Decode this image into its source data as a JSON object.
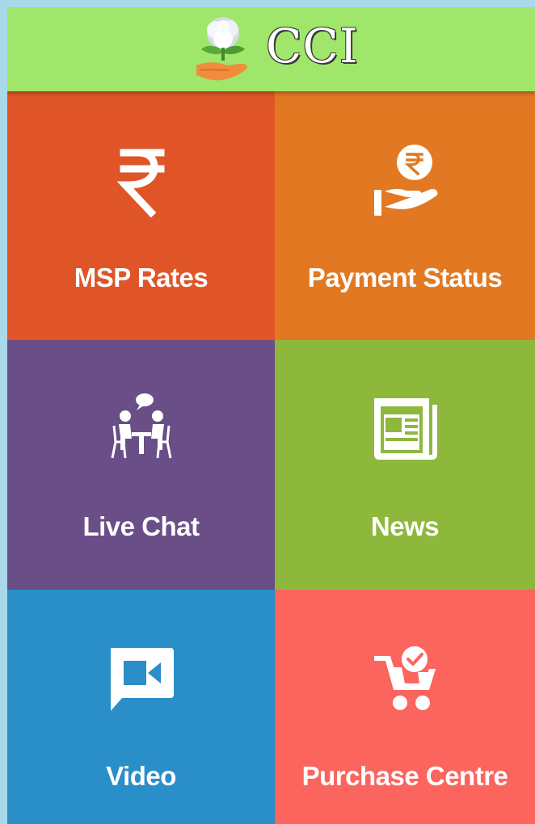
{
  "header": {
    "title": "CCI",
    "logo_icon": "cotton-plant-hand-icon"
  },
  "colors": {
    "header": "#9fe66a",
    "msp_rates": "#df5527",
    "payment_status": "#e27822",
    "live_chat": "#6a4e87",
    "news": "#8db83c",
    "video": "#2a8ec8",
    "purchase_centre": "#fc645e"
  },
  "tiles": [
    {
      "label": "MSP Rates",
      "icon": "rupee-icon"
    },
    {
      "label": "Payment Status",
      "icon": "hand-rupee-coin-icon"
    },
    {
      "label": "Live Chat",
      "icon": "people-chatting-icon"
    },
    {
      "label": "News",
      "icon": "newspaper-icon"
    },
    {
      "label": "Video",
      "icon": "video-chat-icon"
    },
    {
      "label": "Purchase Centre",
      "icon": "cart-check-icon"
    }
  ]
}
